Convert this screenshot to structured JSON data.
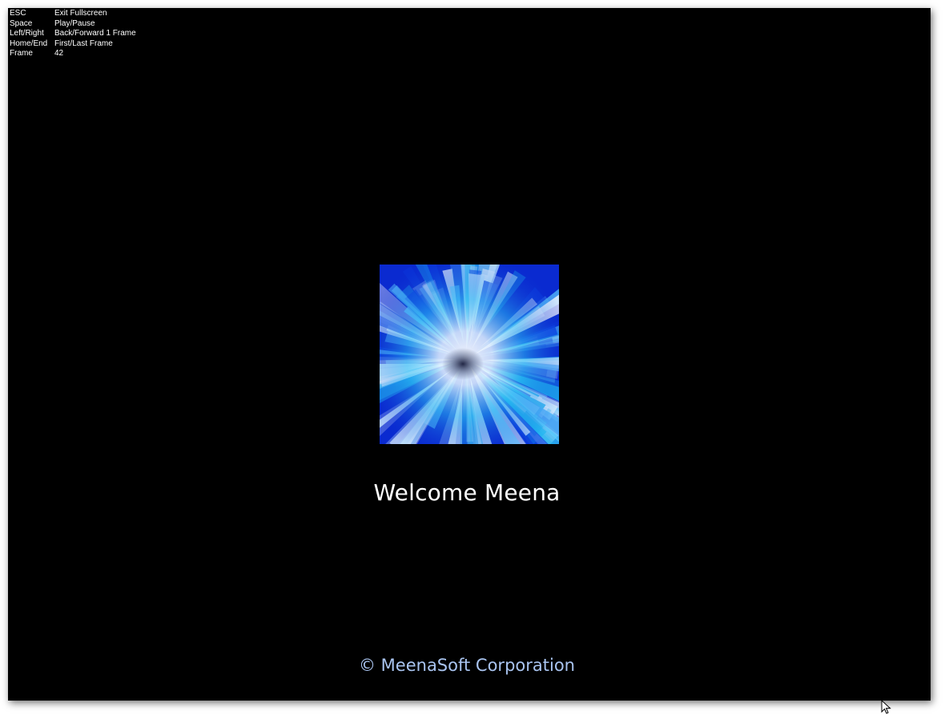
{
  "overlay": {
    "rows": [
      {
        "key": "ESC",
        "action": "Exit Fullscreen"
      },
      {
        "key": "Space",
        "action": "Play/Pause"
      },
      {
        "key": "Left/Right",
        "action": "Back/Forward 1 Frame"
      },
      {
        "key": "Home/End",
        "action": "First/Last Frame"
      },
      {
        "key": "Frame",
        "action": "42"
      }
    ]
  },
  "welcome_text": "Welcome Meena",
  "copyright_text": "© MeenaSoft Corporation",
  "icons": {
    "splash": "blue-starburst-image",
    "cursor": "arrow-cursor-icon"
  },
  "colors": {
    "background": "#000000",
    "welcome_text": "#ffffff",
    "copyright_text": "#a9c4f0",
    "burst_blue": "#0a2ad0",
    "burst_cyan": "#1fb6f0"
  }
}
